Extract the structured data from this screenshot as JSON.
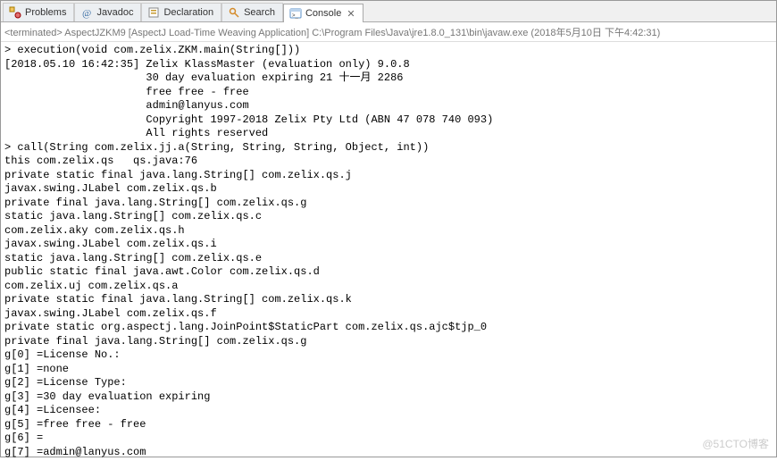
{
  "tabs": [
    {
      "label": "Problems",
      "icon": "problems-icon"
    },
    {
      "label": "Javadoc",
      "icon": "javadoc-icon"
    },
    {
      "label": "Declaration",
      "icon": "declaration-icon"
    },
    {
      "label": "Search",
      "icon": "search-icon"
    },
    {
      "label": "Console",
      "icon": "console-icon",
      "active": true,
      "closable": true
    }
  ],
  "terminated": "<terminated> AspectJZKM9 [AspectJ Load-Time Weaving Application] C:\\Program Files\\Java\\jre1.8.0_131\\bin\\javaw.exe (2018年5月10日 下午4:42:31)",
  "console_lines": [
    "> execution(void com.zelix.ZKM.main(String[]))",
    "[2018.05.10 16:42:35] Zelix KlassMaster (evaluation only) 9.0.8",
    "                      30 day evaluation expiring 21 十一月 2286",
    "                      free free - free",
    "                      admin@lanyus.com",
    "                      Copyright 1997-2018 Zelix Pty Ltd (ABN 47 078 740 093)",
    "                      All rights reserved",
    "> call(String com.zelix.jj.a(String, String, String, Object, int))",
    "this com.zelix.qs   qs.java:76",
    "private static final java.lang.String[] com.zelix.qs.j",
    "javax.swing.JLabel com.zelix.qs.b",
    "private final java.lang.String[] com.zelix.qs.g",
    "static java.lang.String[] com.zelix.qs.c",
    "com.zelix.aky com.zelix.qs.h",
    "javax.swing.JLabel com.zelix.qs.i",
    "static java.lang.String[] com.zelix.qs.e",
    "public static final java.awt.Color com.zelix.qs.d",
    "com.zelix.uj com.zelix.qs.a",
    "private static final java.lang.String[] com.zelix.qs.k",
    "javax.swing.JLabel com.zelix.qs.f",
    "private static org.aspectj.lang.JoinPoint$StaticPart com.zelix.qs.ajc$tjp_0",
    "private final java.lang.String[] com.zelix.qs.g",
    "g[0] =License No.:",
    "g[1] =none",
    "g[2] =License Type:",
    "g[3] =30 day evaluation expiring",
    "g[4] =Licensee:",
    "g[5] =free free - free",
    "g[6] =",
    "g[7] =admin@lanyus.com"
  ],
  "watermark": "@51CTO博客"
}
